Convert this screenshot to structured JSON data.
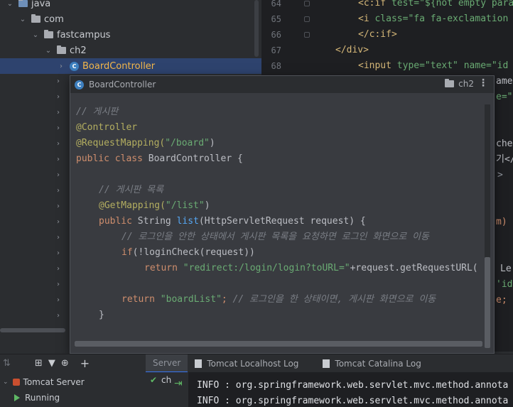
{
  "project_tree": {
    "items": [
      {
        "label": "java",
        "type": "folder"
      },
      {
        "label": "com",
        "type": "folder"
      },
      {
        "label": "fastcampus",
        "type": "folder"
      },
      {
        "label": "ch2",
        "type": "folder"
      },
      {
        "label": "BoardController",
        "type": "class",
        "selected": true
      }
    ]
  },
  "editor_bg": {
    "line_numbers": [
      "64",
      "65",
      "66",
      "67",
      "68"
    ],
    "lines": [
      {
        "tag": "<c:if",
        "rest": " test=\"${not empty para"
      },
      {
        "tag": "<i",
        "rest": " class=\"fa fa-exclamation"
      },
      {
        "tag": "</c:if>",
        "rest": ""
      },
      {
        "tag": "</div>",
        "rest": ""
      },
      {
        "tag": "<input",
        "rest": " type=\"text\" name=\"id"
      }
    ],
    "right_fragments": [
      "ame=",
      "e=\"",
      "che",
      "기</",
      ">",
      "m)",
      "Le",
      "'id-",
      "e;"
    ]
  },
  "popup": {
    "title": "BoardController",
    "package": "ch2",
    "menu_glyph": "⋮",
    "code": {
      "l1": "// 게시판",
      "l2": "@Controller",
      "l3a": "@RequestMapping(",
      "l3b": "\"/board\"",
      "l3c": ")",
      "l4a": "public class ",
      "l4b": "BoardController {",
      "l6": "// 게시판 목록",
      "l7a": "@GetMapping(",
      "l7b": "\"/list\"",
      "l7c": ")",
      "l8a": "public ",
      "l8b": "String ",
      "l8c": "list",
      "l8d": "(HttpServletRequest request) {",
      "l9": "// 로그인을 안한 상태에서 게시판 목록을 요청하면 로그인 화면으로 이동",
      "l10a": "if",
      "l10b": "(!",
      "l10c": "loginCheck",
      "l10d": "(request))",
      "l11a": "return ",
      "l11b": "\"redirect:/login/login?toURL=\"",
      "l11c": "+request.getRequestURL(",
      "l13a": "return ",
      "l13b": "\"boardList\"",
      "l13c": "; ",
      "l13d": "// 로그인을 한 상태이면, 게시판 화면으로 이동",
      "l14": "}"
    }
  },
  "bottom": {
    "toolbar_glyphs": [
      "⇅",
      "⊞",
      "▼",
      "⊕",
      "+"
    ],
    "services": [
      {
        "label": "Tomcat Server"
      },
      {
        "label": "Running"
      }
    ],
    "tabs": [
      {
        "label": "Server",
        "active": true
      },
      {
        "label": "Tomcat Localhost Log",
        "active": false
      },
      {
        "label": "Tomcat Catalina Log",
        "active": false
      }
    ],
    "side_check": "✔",
    "side_text": "ch",
    "log_lines": [
      "INFO : org.springframework.web.servlet.mvc.method.annota",
      "INFO : org.springframework.web.servlet.mvc.method.annota"
    ]
  },
  "colors": {
    "selection": "#2e436e",
    "selected_text": "#f4b74b",
    "keyword": "#cf8e6d",
    "string": "#6aab73",
    "annotation": "#b3ae60",
    "comment": "#7a7e85",
    "method": "#56a8f5"
  }
}
